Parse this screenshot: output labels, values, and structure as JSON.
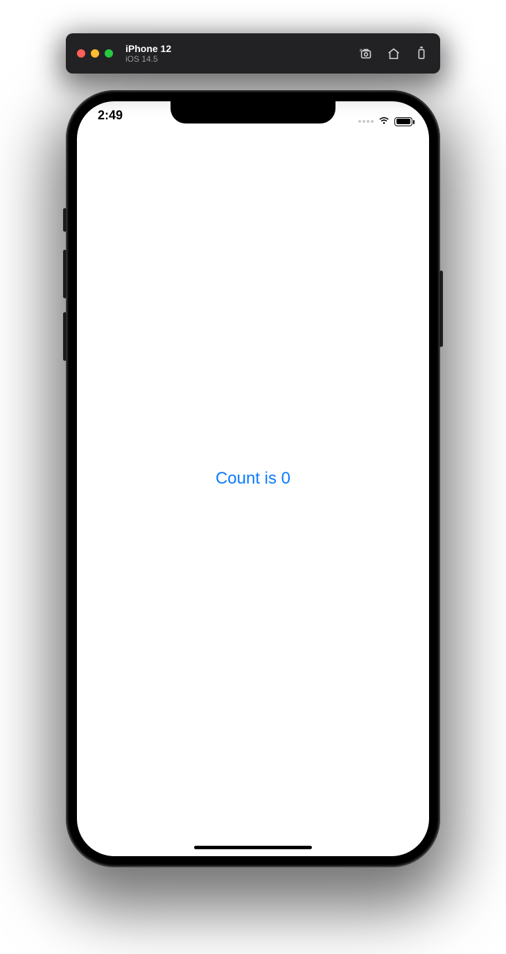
{
  "simulator": {
    "device": "iPhone 12",
    "os": "iOS 14.5",
    "icons": {
      "screenshot": "screenshot-icon",
      "home": "home-icon",
      "rotate": "rotate-icon"
    }
  },
  "statusbar": {
    "time": "2:49"
  },
  "app": {
    "count_label": "Count is 0"
  }
}
